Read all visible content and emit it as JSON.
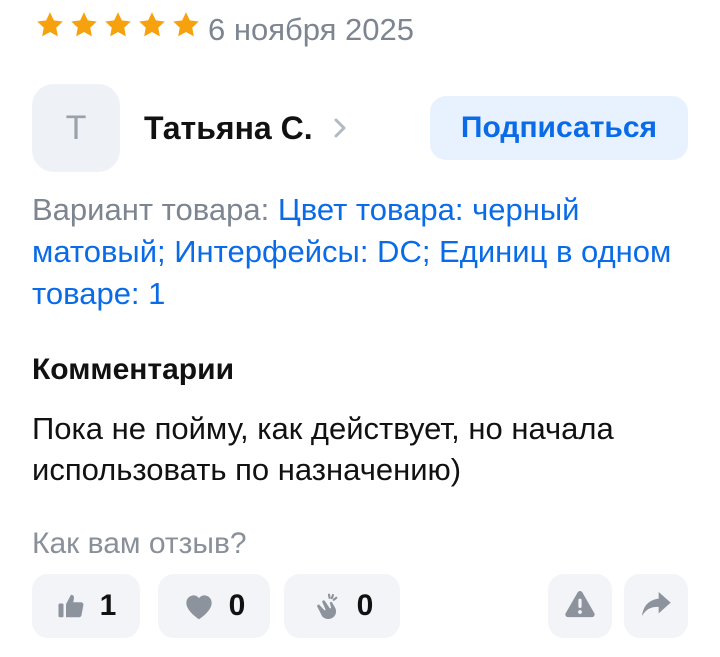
{
  "review": {
    "rating": 5,
    "rating_max": 5,
    "star_color": "#f6a10e",
    "date": "6 ноября 2025"
  },
  "author": {
    "avatar_letter": "Т",
    "name": "Татьяна С.",
    "subscribe_label": "Подписаться"
  },
  "variant": {
    "label": "Вариант товара:",
    "value": "Цвет товара: черный матовый; Интерфейсы: DC; Единиц в одном товаре: 1"
  },
  "comments": {
    "title": "Комментарии",
    "text": "Пока не пойму, как действует, но начала использовать по назначению)"
  },
  "feedback": {
    "question": "Как вам отзыв?",
    "reactions": [
      {
        "icon": "thumbs-up-icon",
        "count": "1"
      },
      {
        "icon": "heart-icon",
        "count": "0"
      },
      {
        "icon": "clapping-hands-icon",
        "count": "0"
      }
    ],
    "actions": [
      {
        "icon": "warning-icon"
      },
      {
        "icon": "share-icon"
      }
    ]
  },
  "colors": {
    "accent": "#0a6be8",
    "accent_bg": "#e8f2fe",
    "button_bg": "#f2f4f8",
    "muted_text": "#7d8590"
  }
}
